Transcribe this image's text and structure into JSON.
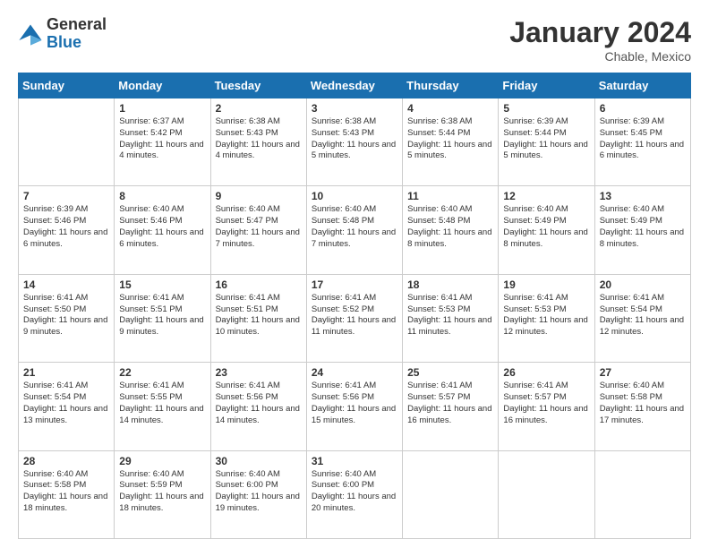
{
  "header": {
    "logo_general": "General",
    "logo_blue": "Blue",
    "month_title": "January 2024",
    "location": "Chable, Mexico"
  },
  "days_of_week": [
    "Sunday",
    "Monday",
    "Tuesday",
    "Wednesday",
    "Thursday",
    "Friday",
    "Saturday"
  ],
  "weeks": [
    [
      {
        "day": "",
        "sunrise": "",
        "sunset": "",
        "daylight": ""
      },
      {
        "day": "1",
        "sunrise": "6:37 AM",
        "sunset": "5:42 PM",
        "daylight": "11 hours and 4 minutes."
      },
      {
        "day": "2",
        "sunrise": "6:38 AM",
        "sunset": "5:43 PM",
        "daylight": "11 hours and 4 minutes."
      },
      {
        "day": "3",
        "sunrise": "6:38 AM",
        "sunset": "5:43 PM",
        "daylight": "11 hours and 5 minutes."
      },
      {
        "day": "4",
        "sunrise": "6:38 AM",
        "sunset": "5:44 PM",
        "daylight": "11 hours and 5 minutes."
      },
      {
        "day": "5",
        "sunrise": "6:39 AM",
        "sunset": "5:44 PM",
        "daylight": "11 hours and 5 minutes."
      },
      {
        "day": "6",
        "sunrise": "6:39 AM",
        "sunset": "5:45 PM",
        "daylight": "11 hours and 6 minutes."
      }
    ],
    [
      {
        "day": "7",
        "sunrise": "6:39 AM",
        "sunset": "5:46 PM",
        "daylight": "11 hours and 6 minutes."
      },
      {
        "day": "8",
        "sunrise": "6:40 AM",
        "sunset": "5:46 PM",
        "daylight": "11 hours and 6 minutes."
      },
      {
        "day": "9",
        "sunrise": "6:40 AM",
        "sunset": "5:47 PM",
        "daylight": "11 hours and 7 minutes."
      },
      {
        "day": "10",
        "sunrise": "6:40 AM",
        "sunset": "5:48 PM",
        "daylight": "11 hours and 7 minutes."
      },
      {
        "day": "11",
        "sunrise": "6:40 AM",
        "sunset": "5:48 PM",
        "daylight": "11 hours and 8 minutes."
      },
      {
        "day": "12",
        "sunrise": "6:40 AM",
        "sunset": "5:49 PM",
        "daylight": "11 hours and 8 minutes."
      },
      {
        "day": "13",
        "sunrise": "6:40 AM",
        "sunset": "5:49 PM",
        "daylight": "11 hours and 8 minutes."
      }
    ],
    [
      {
        "day": "14",
        "sunrise": "6:41 AM",
        "sunset": "5:50 PM",
        "daylight": "11 hours and 9 minutes."
      },
      {
        "day": "15",
        "sunrise": "6:41 AM",
        "sunset": "5:51 PM",
        "daylight": "11 hours and 9 minutes."
      },
      {
        "day": "16",
        "sunrise": "6:41 AM",
        "sunset": "5:51 PM",
        "daylight": "11 hours and 10 minutes."
      },
      {
        "day": "17",
        "sunrise": "6:41 AM",
        "sunset": "5:52 PM",
        "daylight": "11 hours and 11 minutes."
      },
      {
        "day": "18",
        "sunrise": "6:41 AM",
        "sunset": "5:53 PM",
        "daylight": "11 hours and 11 minutes."
      },
      {
        "day": "19",
        "sunrise": "6:41 AM",
        "sunset": "5:53 PM",
        "daylight": "11 hours and 12 minutes."
      },
      {
        "day": "20",
        "sunrise": "6:41 AM",
        "sunset": "5:54 PM",
        "daylight": "11 hours and 12 minutes."
      }
    ],
    [
      {
        "day": "21",
        "sunrise": "6:41 AM",
        "sunset": "5:54 PM",
        "daylight": "11 hours and 13 minutes."
      },
      {
        "day": "22",
        "sunrise": "6:41 AM",
        "sunset": "5:55 PM",
        "daylight": "11 hours and 14 minutes."
      },
      {
        "day": "23",
        "sunrise": "6:41 AM",
        "sunset": "5:56 PM",
        "daylight": "11 hours and 14 minutes."
      },
      {
        "day": "24",
        "sunrise": "6:41 AM",
        "sunset": "5:56 PM",
        "daylight": "11 hours and 15 minutes."
      },
      {
        "day": "25",
        "sunrise": "6:41 AM",
        "sunset": "5:57 PM",
        "daylight": "11 hours and 16 minutes."
      },
      {
        "day": "26",
        "sunrise": "6:41 AM",
        "sunset": "5:57 PM",
        "daylight": "11 hours and 16 minutes."
      },
      {
        "day": "27",
        "sunrise": "6:40 AM",
        "sunset": "5:58 PM",
        "daylight": "11 hours and 17 minutes."
      }
    ],
    [
      {
        "day": "28",
        "sunrise": "6:40 AM",
        "sunset": "5:58 PM",
        "daylight": "11 hours and 18 minutes."
      },
      {
        "day": "29",
        "sunrise": "6:40 AM",
        "sunset": "5:59 PM",
        "daylight": "11 hours and 18 minutes."
      },
      {
        "day": "30",
        "sunrise": "6:40 AM",
        "sunset": "6:00 PM",
        "daylight": "11 hours and 19 minutes."
      },
      {
        "day": "31",
        "sunrise": "6:40 AM",
        "sunset": "6:00 PM",
        "daylight": "11 hours and 20 minutes."
      },
      {
        "day": "",
        "sunrise": "",
        "sunset": "",
        "daylight": ""
      },
      {
        "day": "",
        "sunrise": "",
        "sunset": "",
        "daylight": ""
      },
      {
        "day": "",
        "sunrise": "",
        "sunset": "",
        "daylight": ""
      }
    ]
  ]
}
